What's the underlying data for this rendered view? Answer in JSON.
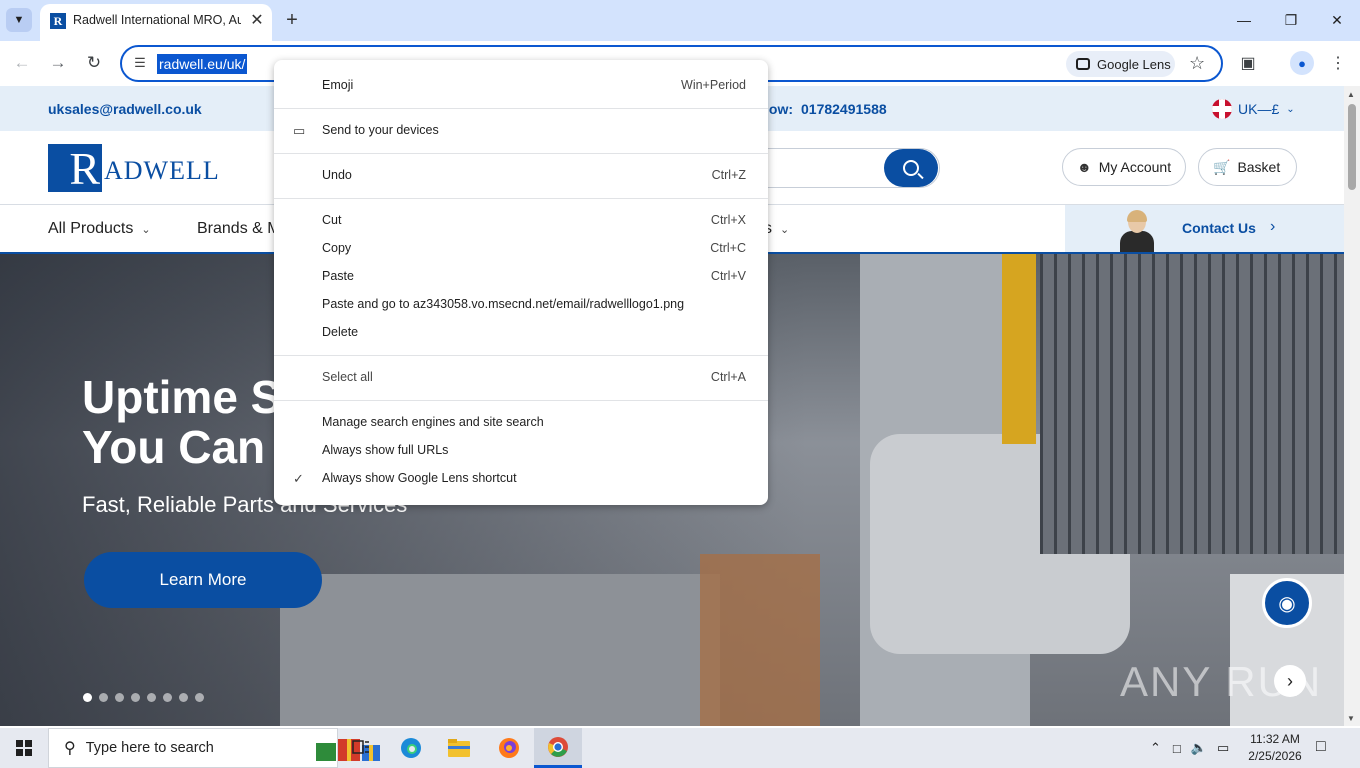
{
  "browser": {
    "tab_title": "Radwell International MRO, Aut",
    "favicon_letter": "R",
    "url": "radwell.eu/uk/",
    "lens_label": "Google Lens"
  },
  "site": {
    "email": "uksales@radwell.co.uk",
    "phone_label": "low:",
    "phone": "01782491588",
    "region": "UK—£",
    "logo_letter": "R",
    "logo_text": "ADWELL",
    "my_account": "My Account",
    "basket": "Basket",
    "nav": [
      "All Products",
      "Brands & M",
      "s"
    ],
    "contact": "Contact Us",
    "hero_title_1": "Uptime S",
    "hero_title_2": "You Can",
    "hero_sub": "Fast, Reliable Parts and Services",
    "learn_more": "Learn More",
    "watermark": "ANY RUN"
  },
  "context_menu": {
    "items": [
      {
        "label": "Emoji",
        "shortcut": "Win+Period"
      },
      {
        "label": "Send to your devices",
        "shortcut": ""
      },
      {
        "label": "Undo",
        "shortcut": "Ctrl+Z"
      },
      {
        "label": "Cut",
        "shortcut": "Ctrl+X"
      },
      {
        "label": "Copy",
        "shortcut": "Ctrl+C"
      },
      {
        "label": "Paste",
        "shortcut": "Ctrl+V"
      },
      {
        "label": "Paste and go to az343058.vo.msecnd.net/email/radwelllogo1.png",
        "shortcut": ""
      },
      {
        "label": "Delete",
        "shortcut": ""
      },
      {
        "label": "Select all",
        "shortcut": "Ctrl+A"
      },
      {
        "label": "Manage search engines and site search",
        "shortcut": ""
      },
      {
        "label": "Always show full URLs",
        "shortcut": ""
      },
      {
        "label": "Always show Google Lens shortcut",
        "shortcut": ""
      }
    ]
  },
  "taskbar": {
    "search_placeholder": "Type here to search",
    "time": "11:32 AM",
    "date": "2/25/2026"
  },
  "colors": {
    "brand_blue": "#0a4ea2",
    "chrome_accent": "#0b57d0"
  }
}
